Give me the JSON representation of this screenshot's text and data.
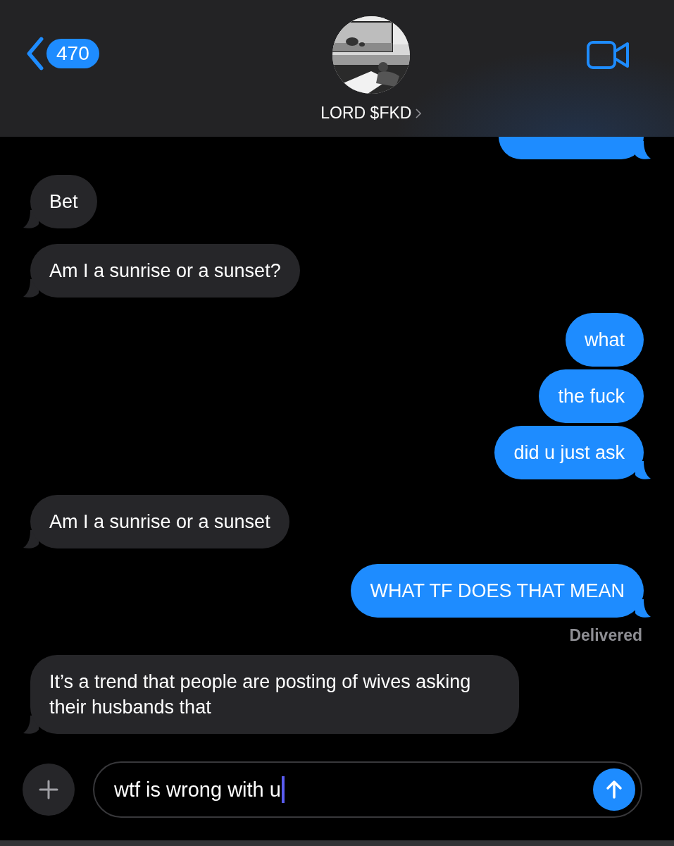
{
  "header": {
    "back_count": "470",
    "contact_name": "LORD $FKD"
  },
  "clipped_bubble": {
    "kind": "me"
  },
  "messages": [
    {
      "kind": "them",
      "text": "Bet",
      "tail": true
    },
    {
      "kind": "them",
      "text": "Am I a sunrise or a sunset?",
      "tail": true
    },
    {
      "kind": "me",
      "text": "what",
      "tail": false
    },
    {
      "kind": "me",
      "text": "the fuck",
      "tail": false
    },
    {
      "kind": "me",
      "text": "did u just ask",
      "tail": true
    },
    {
      "kind": "them",
      "text": "Am I a sunrise or a sunset",
      "tail": true
    },
    {
      "kind": "me",
      "text": "WHAT TF DOES THAT MEAN",
      "tail": true,
      "status": "Delivered"
    },
    {
      "kind": "them",
      "text": "It’s a trend that people are posting of wives asking their husbands that",
      "tail": true
    }
  ],
  "composer": {
    "value": "wtf is wrong with u"
  }
}
